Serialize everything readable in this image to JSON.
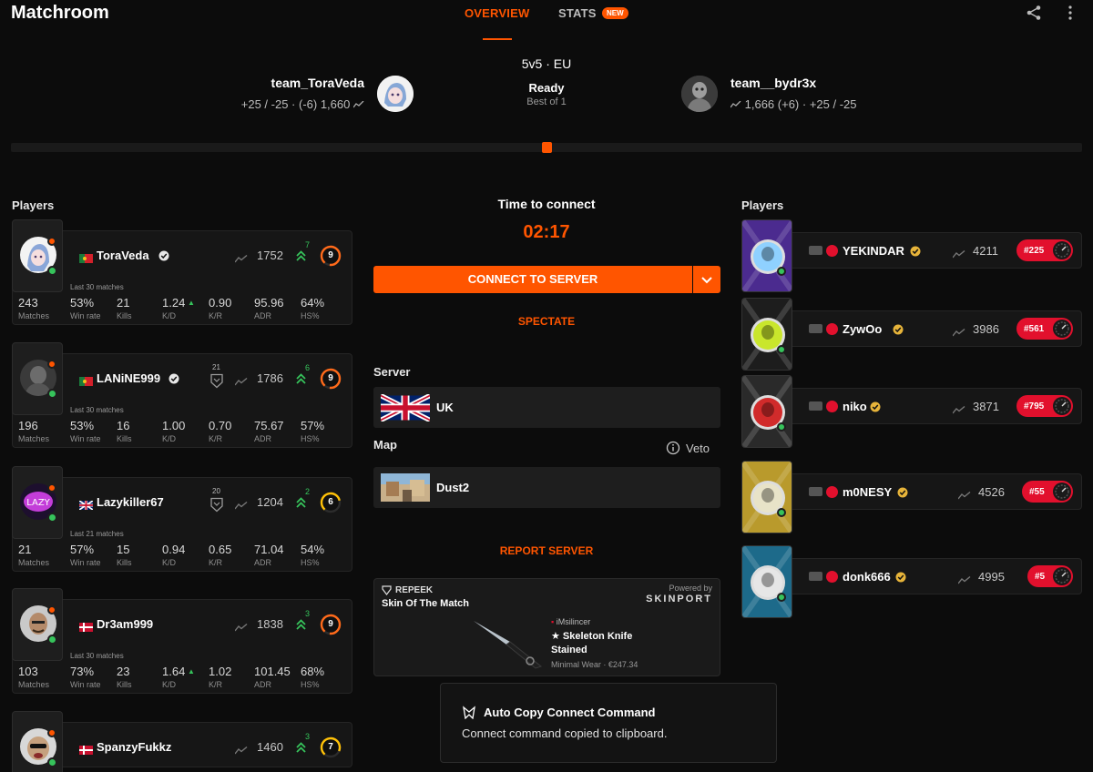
{
  "header": {
    "title": "Matchroom",
    "tabs": [
      "OVERVIEW",
      "STATS"
    ],
    "new_badge": "NEW",
    "share_icon": "share-icon",
    "more_icon": "more-vertical-icon"
  },
  "match": {
    "mode": "5v5 · EU",
    "status": "Ready",
    "format": "Best of 1"
  },
  "team_left": {
    "name": "team_ToraVeda",
    "stats_a": "+25 / -25",
    "stats_b": "(-6) 1,660"
  },
  "team_right": {
    "name": "team__bydr3x",
    "stats_a": "1,666 (+6)",
    "stats_b": "+25 / -25"
  },
  "players_label": "Players",
  "left_players": [
    {
      "name": "ToraVeda",
      "elo": "1752",
      "trend": "7",
      "level": "9",
      "caption": "Last 30 matches",
      "stats": [
        "243",
        "53%",
        "21",
        "1.24",
        "0.90",
        "95.96",
        "64%"
      ],
      "flag": "portugal"
    },
    {
      "name": "LANiNE999",
      "elo": "1786",
      "trend": "6",
      "level": "9",
      "rank": "21",
      "caption": "Last 30 matches",
      "stats": [
        "196",
        "53%",
        "16",
        "1.00",
        "0.70",
        "75.67",
        "57%"
      ],
      "flag": "portugal"
    },
    {
      "name": "Lazykiller67",
      "elo": "1204",
      "trend": "2",
      "level": "6",
      "rank": "20",
      "caption": "Last 21 matches",
      "stats": [
        "21",
        "57%",
        "15",
        "0.94",
        "0.65",
        "71.04",
        "54%"
      ],
      "flag": "uk"
    },
    {
      "name": "Dr3am999",
      "elo": "1838",
      "trend": "3",
      "level": "9",
      "caption": "Last 30 matches",
      "stats": [
        "103",
        "73%",
        "23",
        "1.64",
        "1.02",
        "101.45",
        "68%"
      ],
      "flag": "denmark"
    },
    {
      "name": "SpanzyFukkz",
      "elo": "1460",
      "trend": "3",
      "level": "7",
      "flag": "denmark"
    }
  ],
  "stat_labels": [
    "Matches",
    "Win rate",
    "Kills",
    "K/D",
    "K/R",
    "ADR",
    "HS%"
  ],
  "right_players": [
    {
      "name": "YEKINDAR",
      "elo": "4211",
      "rank": "#225"
    },
    {
      "name": "ZywOo",
      "elo": "3986",
      "rank": "#561"
    },
    {
      "name": "niko",
      "elo": "3871",
      "rank": "#795"
    },
    {
      "name": "m0NESY",
      "elo": "4526",
      "rank": "#55"
    },
    {
      "name": "donk666",
      "elo": "4995",
      "rank": "#5"
    }
  ],
  "center": {
    "time_label": "Time to connect",
    "countdown": "02:17",
    "connect_label": "CONNECT TO SERVER",
    "spectate_label": "SPECTATE",
    "server_label": "Server",
    "server_value": "UK",
    "map_label": "Map",
    "veto_label": "Veto",
    "map_value": "Dust2",
    "report_label": "REPORT SERVER"
  },
  "skin": {
    "brand": "REPEEK",
    "heading": "Skin Of The Match",
    "powered": "Powered by",
    "powered_brand": "SKINPORT",
    "owner": "iMsilincer",
    "item_name": "★ Skeleton Knife",
    "item_finish": "Stained",
    "item_meta": "Minimal Wear · €247.34"
  },
  "toast": {
    "title": "Auto Copy Connect Command",
    "message": "Connect command copied to clipboard."
  },
  "colors": {
    "accent": "#ff5500",
    "rank_red": "#e2102d",
    "trend_green": "#36c35b"
  }
}
